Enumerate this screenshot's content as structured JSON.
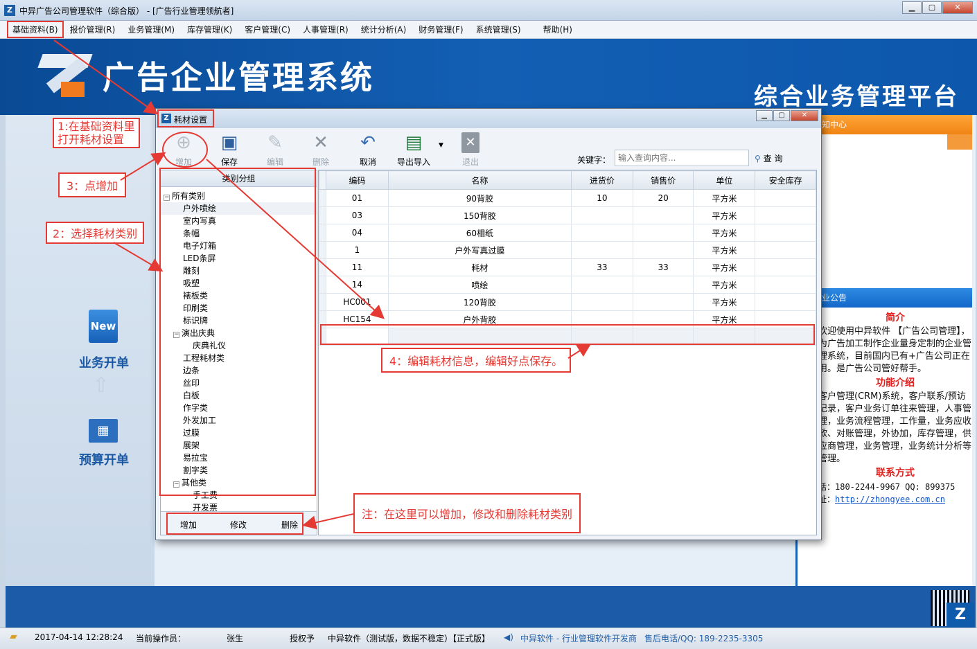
{
  "window": {
    "title": "中异广告公司管理软件（综合版） - [广告行业管理领航者]"
  },
  "menu": [
    {
      "label": "基础资料(B)"
    },
    {
      "label": "报价管理(R)"
    },
    {
      "label": "业务管理(M)"
    },
    {
      "label": "库存管理(K)"
    },
    {
      "label": "客户管理(C)"
    },
    {
      "label": "人事管理(R)"
    },
    {
      "label": "统计分析(A)"
    },
    {
      "label": "财务管理(F)"
    },
    {
      "label": "系统管理(S)"
    },
    {
      "label": "帮助(H)"
    }
  ],
  "banner": {
    "system_name": "广告企业管理系统",
    "platform": "综合业务管理平台"
  },
  "quick_actions": {
    "new_badge": "New",
    "business": "业务开单",
    "budget": "预算开单"
  },
  "right_panel": {
    "notice_center": "知中心",
    "announcement": "业公告",
    "intro_title": "简介",
    "intro_text": "欢迎使用中异软件 【广告公司管理】，为广告加工制作企业量身定制的企业管理系统，目前国内已有+广告公司正在用。是广告公司管好帮手。",
    "features_title": "功能介绍",
    "features_text": "客户管理(CRM)系统，客户联系/预访记录，客户业务订单往来管理，人事管理，业务流程管理，工作量，业务应收款、对账管理，外协加，库存管理，供应商管理，业务管理，业务统计分析等管理。",
    "contact_title": "联系方式",
    "phone": "话：180-2244-9967  QQ: 899375",
    "website_label": "址：",
    "website": "http://zhongyee.com.cn"
  },
  "status_bar": {
    "datetime": "2017-04-14 12:28:24",
    "operator_label": "当前操作员：",
    "operator": "张生",
    "license_label": "授权予",
    "edition": "中异软件（测试版，数据不稳定）【正式版】",
    "company": "中异软件 - 行业管理软件开发商",
    "hotline": "售后电话/QQ: 189-2235-3305"
  },
  "dialog": {
    "title": "耗材设置",
    "toolbar": [
      {
        "label": "增加",
        "icon": "add-doc-icon",
        "enabled": false
      },
      {
        "label": "保存",
        "icon": "save-icon",
        "enabled": true
      },
      {
        "label": "编辑",
        "icon": "edit-icon",
        "enabled": false
      },
      {
        "label": "删除",
        "icon": "delete-icon",
        "enabled": false
      },
      {
        "label": "取消",
        "icon": "undo-icon",
        "enabled": true
      },
      {
        "label": "导出导入",
        "icon": "excel-icon",
        "enabled": true
      },
      {
        "label": "退出",
        "icon": "exit-icon",
        "enabled": false
      }
    ],
    "keyword_label": "关键字：",
    "keyword_placeholder": "输入查询内容...",
    "search_label": "查 询",
    "group_header": "类别分组",
    "tree": {
      "root": "所有类别",
      "items": [
        "户外喷绘",
        "室内写真",
        "条幅",
        "电子灯箱",
        "LED条屏",
        "雕刻",
        "吸塑",
        "裱板类",
        "印刷类",
        "标识牌"
      ],
      "group1": {
        "label": "演出庆典",
        "children": [
          "庆典礼仪"
        ]
      },
      "items2": [
        "工程耗材类",
        "边条",
        "丝印",
        "白板",
        "作字类",
        "外发加工",
        "过膜",
        "展架",
        "易拉宝",
        "割字类"
      ],
      "group2": {
        "label": "其他类",
        "children": [
          "手工费",
          "开发票"
        ]
      }
    },
    "group_actions": {
      "add": "增加",
      "modify": "修改",
      "delete": "删除"
    },
    "columns": [
      "编码",
      "名称",
      "进货价",
      "销售价",
      "单位",
      "安全库存"
    ],
    "rows": [
      {
        "code": "01",
        "name": "90背胶",
        "cost": "10",
        "price": "20",
        "unit": "平方米",
        "stock": ""
      },
      {
        "code": "03",
        "name": "150背胶",
        "cost": "",
        "price": "",
        "unit": "平方米",
        "stock": ""
      },
      {
        "code": "04",
        "name": "60相纸",
        "cost": "",
        "price": "",
        "unit": "平方米",
        "stock": ""
      },
      {
        "code": "1",
        "name": "户外写真过膜",
        "cost": "",
        "price": "",
        "unit": "平方米",
        "stock": ""
      },
      {
        "code": "11",
        "name": "耗材",
        "cost": "33",
        "price": "33",
        "unit": "平方米",
        "stock": ""
      },
      {
        "code": "14",
        "name": "喷绘",
        "cost": "",
        "price": "",
        "unit": "平方米",
        "stock": ""
      },
      {
        "code": "HC001",
        "name": "120背胶",
        "cost": "",
        "price": "",
        "unit": "平方米",
        "stock": ""
      },
      {
        "code": "HC154",
        "name": "户外背胶",
        "cost": "",
        "price": "",
        "unit": "平方米",
        "stock": ""
      }
    ]
  },
  "annotations": {
    "step1": "1:在基础资料里\n打开耗材设置",
    "step2": "2：选择耗材类别",
    "step3": "3：点增加",
    "step4": "4：编辑耗材信息，编辑好点保存。",
    "note": "注：在这里可以增加，修改和删除耗材类别",
    "color": "#e53a34"
  }
}
